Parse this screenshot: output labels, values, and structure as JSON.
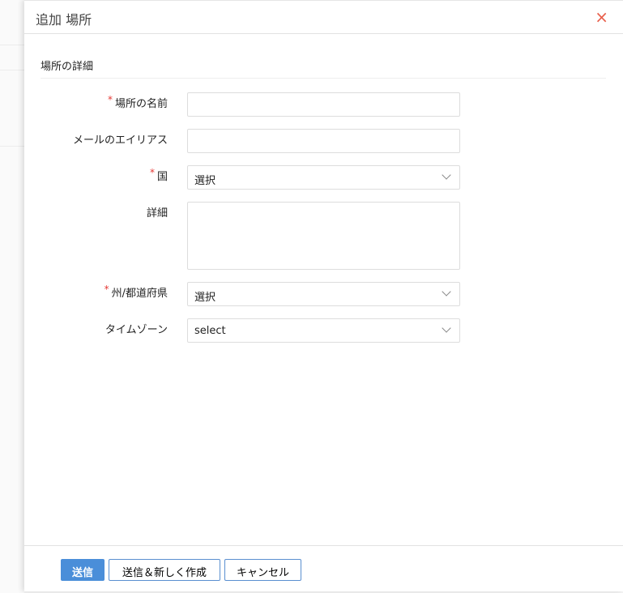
{
  "dialog": {
    "title": "追加 場所",
    "close_icon": "×"
  },
  "section": {
    "title": "場所の詳細"
  },
  "fields": [
    {
      "label": "場所の名前",
      "required": true,
      "type": "text",
      "value": ""
    },
    {
      "label": "メールのエイリアス",
      "required": false,
      "type": "text",
      "value": ""
    },
    {
      "label": "国",
      "required": true,
      "type": "select",
      "value": "選択"
    },
    {
      "label": "詳細",
      "required": false,
      "type": "textarea",
      "value": ""
    },
    {
      "label": "州/都道府県",
      "required": true,
      "type": "select",
      "value": "選択"
    },
    {
      "label": "タイムゾーン",
      "required": false,
      "type": "select",
      "value": "select"
    }
  ],
  "required_mark": "*",
  "footer": {
    "submit": "送信",
    "submit_new": "送信＆新しく作成",
    "cancel": "キャンセル"
  },
  "colors": {
    "primary": "#4a8ed9",
    "close": "#e8604c",
    "required": "#e53935"
  }
}
